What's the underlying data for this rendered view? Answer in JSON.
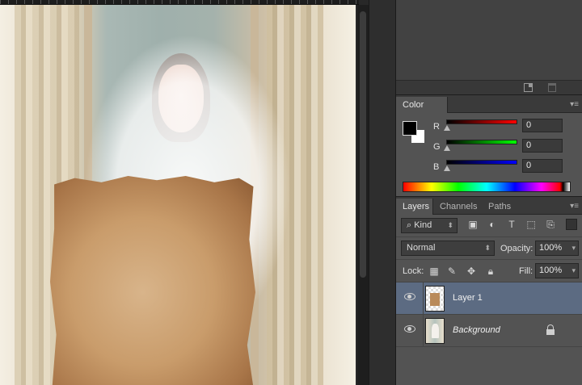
{
  "color_panel": {
    "tab": "Color",
    "channels": [
      {
        "label": "R",
        "value": "0",
        "gradient_end": "#ff0000"
      },
      {
        "label": "G",
        "value": "0",
        "gradient_end": "#00ff00"
      },
      {
        "label": "B",
        "value": "0",
        "gradient_end": "#0000ff"
      }
    ],
    "foreground_color": "#000000",
    "background_color": "#ffffff"
  },
  "layers_panel": {
    "tabs": [
      "Layers",
      "Channels",
      "Paths"
    ],
    "active_tab": "Layers",
    "filter_kind": "Kind",
    "blend_mode": "Normal",
    "opacity_label": "Opacity:",
    "opacity_value": "100%",
    "lock_label": "Lock:",
    "fill_label": "Fill:",
    "fill_value": "100%",
    "layers": [
      {
        "name": "Layer 1",
        "visible": true,
        "selected": true,
        "locked": false
      },
      {
        "name": "Background",
        "visible": true,
        "selected": false,
        "locked": true
      }
    ]
  },
  "accent_colors": {
    "selected_layer": "#5c6b82",
    "panel_bg": "#535353",
    "dock_bg": "#282828"
  }
}
